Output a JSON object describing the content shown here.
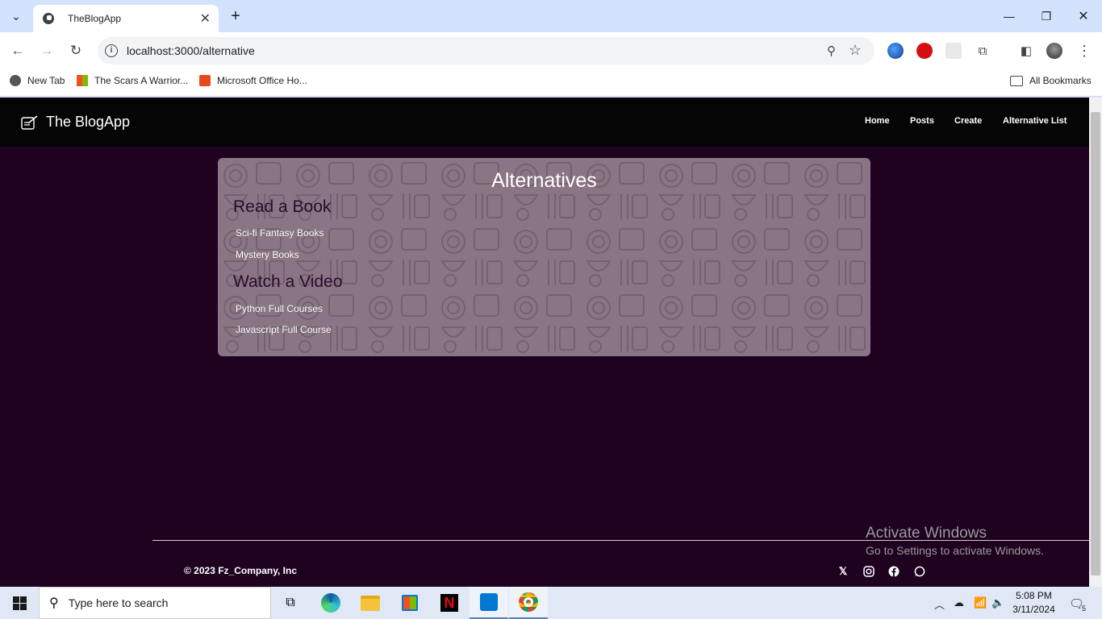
{
  "browser": {
    "tab_title": "TheBlogApp",
    "url": "localhost:3000/alternative",
    "bookmarks": [
      "New Tab",
      "The Scars A Warrior...",
      "Microsoft Office Ho...",
      "All Bookmarks"
    ]
  },
  "navbar": {
    "brand": "The BlogApp",
    "links": [
      "Home",
      "Posts",
      "Create",
      "Alternative List"
    ]
  },
  "card": {
    "heading": "Alternatives",
    "sections": [
      {
        "title": "Read a Book",
        "items": [
          "Sci-fi Fantasy Books",
          "Mystery Books"
        ]
      },
      {
        "title": "Watch a Video",
        "items": [
          "Python Full Courses",
          "Javascript Full Course"
        ]
      }
    ]
  },
  "footer": {
    "copyright": "© 2023 Fz_Company, Inc",
    "social_icons": [
      "x-icon",
      "instagram-icon",
      "facebook-icon",
      "whatsapp-icon"
    ]
  },
  "watermark": {
    "line1": "Activate Windows",
    "line2": "Go to Settings to activate Windows."
  },
  "taskbar": {
    "search_placeholder": "Type here to search",
    "time": "5:08 PM",
    "date": "3/11/2024",
    "notification_count": "5"
  },
  "colors": {
    "page_bg": "#1e0220",
    "navbar_bg": "#050505",
    "card_bg": "#8a7585",
    "section_title": "#2a0a2e"
  }
}
